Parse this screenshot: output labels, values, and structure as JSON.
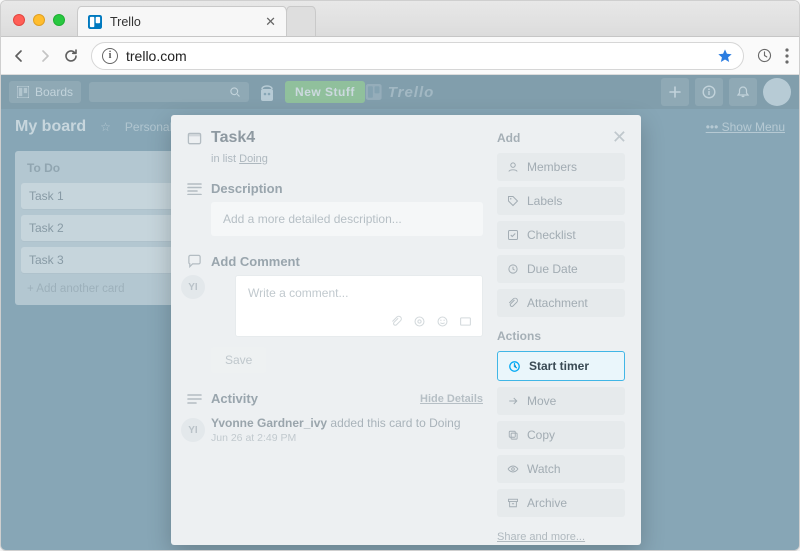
{
  "browser": {
    "tab_title": "Trello",
    "url": "trello.com"
  },
  "trello_top": {
    "boards_label": "Boards",
    "new_stuff": "New Stuff",
    "brand": "Trello"
  },
  "board": {
    "name": "My board",
    "visibility": "Personal",
    "show_menu": "Show Menu"
  },
  "list": {
    "title": "To Do",
    "cards": [
      "Task 1",
      "Task 2",
      "Task 3"
    ],
    "add_card": "+ Add another card"
  },
  "card": {
    "title": "Task4",
    "in_list_prefix": "in list",
    "in_list": "Doing",
    "description_label": "Description",
    "description_placeholder": "Add a more detailed description...",
    "add_comment_label": "Add Comment",
    "comment_placeholder": "Write a comment...",
    "save": "Save",
    "activity_label": "Activity",
    "hide_details": "Hide Details",
    "activity": {
      "initials": "YI",
      "who": "Yvonne Gardner_ivy",
      "action": "added this card to Doing",
      "time": "Jun 26 at 2:49 PM"
    }
  },
  "sidebar": {
    "add_title": "Add",
    "add": [
      {
        "icon": "members-icon",
        "label": "Members"
      },
      {
        "icon": "labels-icon",
        "label": "Labels"
      },
      {
        "icon": "checklist-icon",
        "label": "Checklist"
      },
      {
        "icon": "due-date-icon",
        "label": "Due Date"
      },
      {
        "icon": "attachment-icon",
        "label": "Attachment"
      }
    ],
    "actions_title": "Actions",
    "actions": [
      {
        "icon": "clockify-icon",
        "label": "Start timer",
        "highlight": true
      },
      {
        "icon": "move-icon",
        "label": "Move"
      },
      {
        "icon": "copy-icon",
        "label": "Copy"
      },
      {
        "icon": "watch-icon",
        "label": "Watch"
      },
      {
        "icon": "archive-icon",
        "label": "Archive"
      }
    ],
    "share": "Share and more..."
  }
}
